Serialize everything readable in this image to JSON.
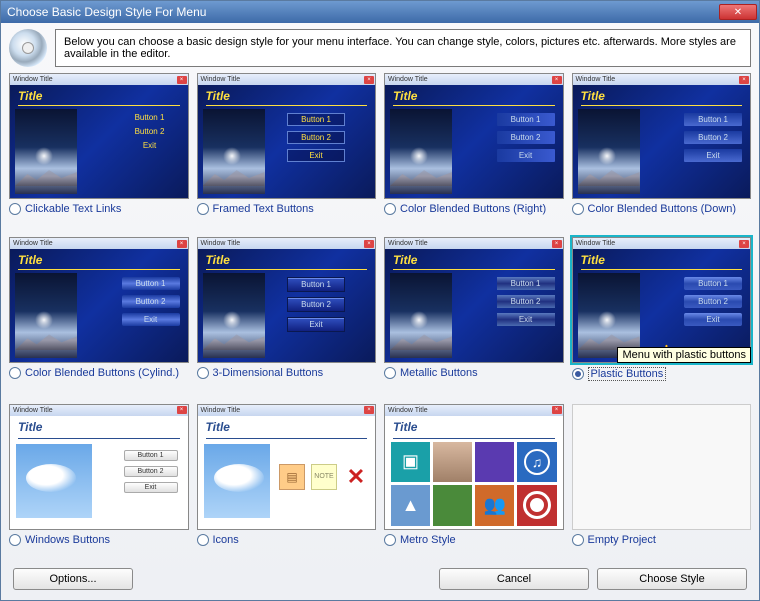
{
  "window": {
    "title": "Choose Basic Design Style For Menu",
    "close_glyph": "✕"
  },
  "info": "Below you can choose a basic design style for your menu interface. You can change style, colors, pictures etc. afterwards. More styles are available in the editor.",
  "thumb_common": {
    "window_title": "Window Title",
    "title": "Title",
    "button1": "Button 1",
    "button2": "Button 2",
    "exit": "Exit",
    "note": "NOTE",
    "x": "✕"
  },
  "styles": [
    {
      "id": "clickable-text-links",
      "label": "Clickable Text Links"
    },
    {
      "id": "framed-text-buttons",
      "label": "Framed Text Buttons"
    },
    {
      "id": "color-blended-right",
      "label": "Color Blended Buttons (Right)"
    },
    {
      "id": "color-blended-down",
      "label": "Color Blended Buttons (Down)"
    },
    {
      "id": "color-blended-cylind",
      "label": "Color Blended Buttons (Cylind.)"
    },
    {
      "id": "3d-buttons",
      "label": "3-Dimensional Buttons"
    },
    {
      "id": "metallic-buttons",
      "label": "Metallic Buttons"
    },
    {
      "id": "plastic-buttons",
      "label": "Plastic Buttons"
    },
    {
      "id": "windows-buttons",
      "label": "Windows Buttons"
    },
    {
      "id": "icons",
      "label": "Icons"
    },
    {
      "id": "metro-style",
      "label": "Metro Style"
    },
    {
      "id": "empty-project",
      "label": "Empty Project"
    }
  ],
  "selected_style": "plastic-buttons",
  "tooltip": "Menu with plastic buttons",
  "footer": {
    "options": "Options...",
    "cancel": "Cancel",
    "choose": "Choose Style"
  },
  "metro_glyphs": {
    "cam": "▣",
    "music": "♫",
    "chart": "▲",
    "people": "👥"
  }
}
